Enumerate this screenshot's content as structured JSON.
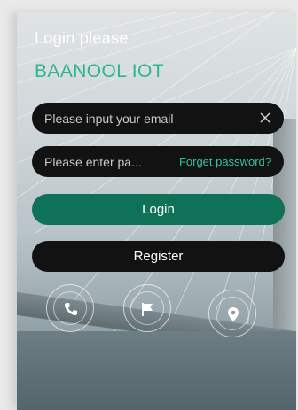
{
  "header": {
    "greeting": "Login please",
    "brand": "BAANOOL IOT"
  },
  "form": {
    "email_placeholder": "Please input your email",
    "password_placeholder": "Please enter pa...",
    "forget_password": "Forget password?"
  },
  "buttons": {
    "login": "Login",
    "register": "Register"
  },
  "bottom_icons": [
    "phone-icon",
    "flag-icon",
    "location-pin-icon"
  ],
  "colors": {
    "brand": "#2bb592",
    "login_button": "#0f7157",
    "field_bg": "#121212"
  }
}
